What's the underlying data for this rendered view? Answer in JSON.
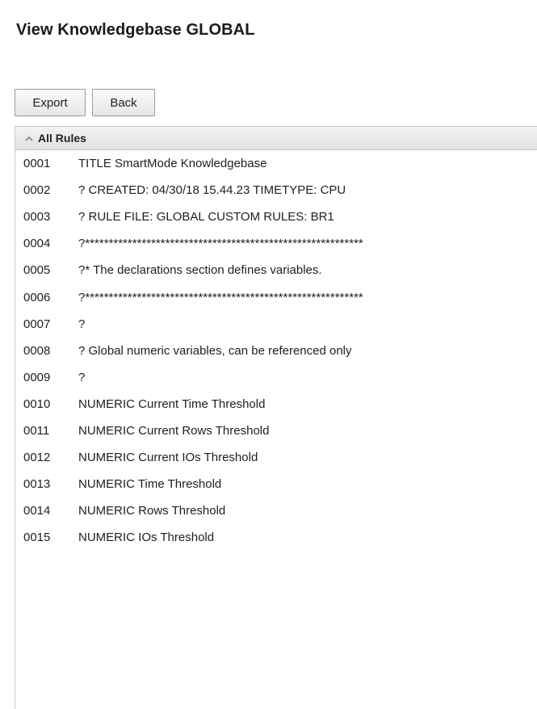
{
  "page": {
    "title": "View Knowledgebase GLOBAL"
  },
  "toolbar": {
    "export_label": "Export",
    "back_label": "Back"
  },
  "panel": {
    "header_label": "All Rules",
    "header_icon": "chevron-up-icon",
    "expanded": true
  },
  "rules": [
    {
      "num": "0001",
      "text": "TITLE SmartMode Knowledgebase"
    },
    {
      "num": "0002",
      "text": "? CREATED: 04/30/18 15.44.23 TIMETYPE: CPU"
    },
    {
      "num": "0003",
      "text": "? RULE FILE: GLOBAL CUSTOM RULES: BR1"
    },
    {
      "num": "0004",
      "text": "?***********************************************************"
    },
    {
      "num": "0005",
      "text": "?* The declarations section defines variables."
    },
    {
      "num": "0006",
      "text": "?***********************************************************"
    },
    {
      "num": "0007",
      "text": "?"
    },
    {
      "num": "0008",
      "text": "? Global numeric variables, can be referenced only"
    },
    {
      "num": "0009",
      "text": "?"
    },
    {
      "num": "0010",
      "text": "NUMERIC Current Time Threshold"
    },
    {
      "num": "0011",
      "text": "NUMERIC Current Rows Threshold"
    },
    {
      "num": "0012",
      "text": "NUMERIC Current IOs Threshold"
    },
    {
      "num": "0013",
      "text": "NUMERIC Time Threshold"
    },
    {
      "num": "0014",
      "text": "NUMERIC Rows Threshold"
    },
    {
      "num": "0015",
      "text": "NUMERIC IOs Threshold"
    }
  ]
}
